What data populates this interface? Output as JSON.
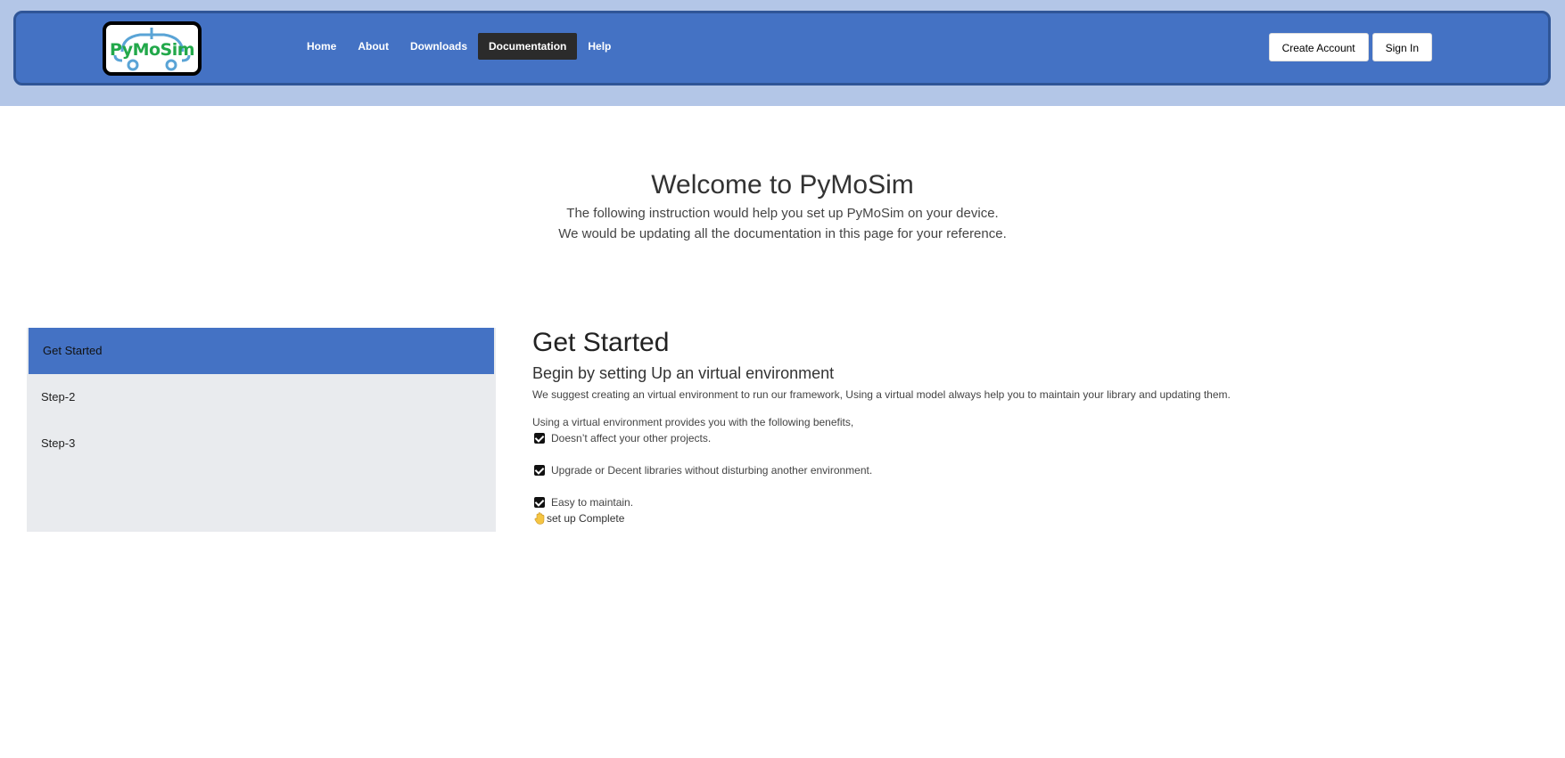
{
  "header": {
    "logo_text": "PyMoSim",
    "nav": [
      {
        "label": "Home"
      },
      {
        "label": "About"
      },
      {
        "label": "Downloads"
      },
      {
        "label": "Documentation",
        "active": true
      },
      {
        "label": "Help"
      }
    ],
    "create_account_label": "Create Account",
    "sign_in_label": "Sign In"
  },
  "hero": {
    "title": "Welcome to PyMoSim",
    "line1": "The following instruction would help you set up PyMoSim on your device.",
    "line2": "We would be updating all the documentation in this page for your reference."
  },
  "sidebar": {
    "items": [
      {
        "label": "Get Started",
        "active": true
      },
      {
        "label": "Step-2"
      },
      {
        "label": "Step-3"
      }
    ]
  },
  "content": {
    "title": "Get Started",
    "subtitle": "Begin by setting Up an virtual environment",
    "paragraph": "We suggest creating an virtual environment to run our framework, Using a virtual model always help you to maintain your library and updating them.",
    "benefits_intro": "Using a virtual environment provides you with the following benefits,",
    "benefits": [
      "Doesn’t affect your other projects.",
      "Upgrade or Decent libraries without disturbing another environment.",
      "Easy to maintain."
    ],
    "complete_text": "set up Complete"
  },
  "colors": {
    "top_band": "#b3c6e7",
    "navbar": "#4472c4",
    "navbar_border": "#2f5597",
    "active_nav": "#2b2b2b",
    "sidebar_bg": "#e9ebee",
    "sidebar_active": "#4472c4",
    "logo_green": "#22a84a"
  },
  "icons": {
    "benefit_check": "checkbox-checked-icon",
    "complete": "hand-emoji-icon"
  }
}
